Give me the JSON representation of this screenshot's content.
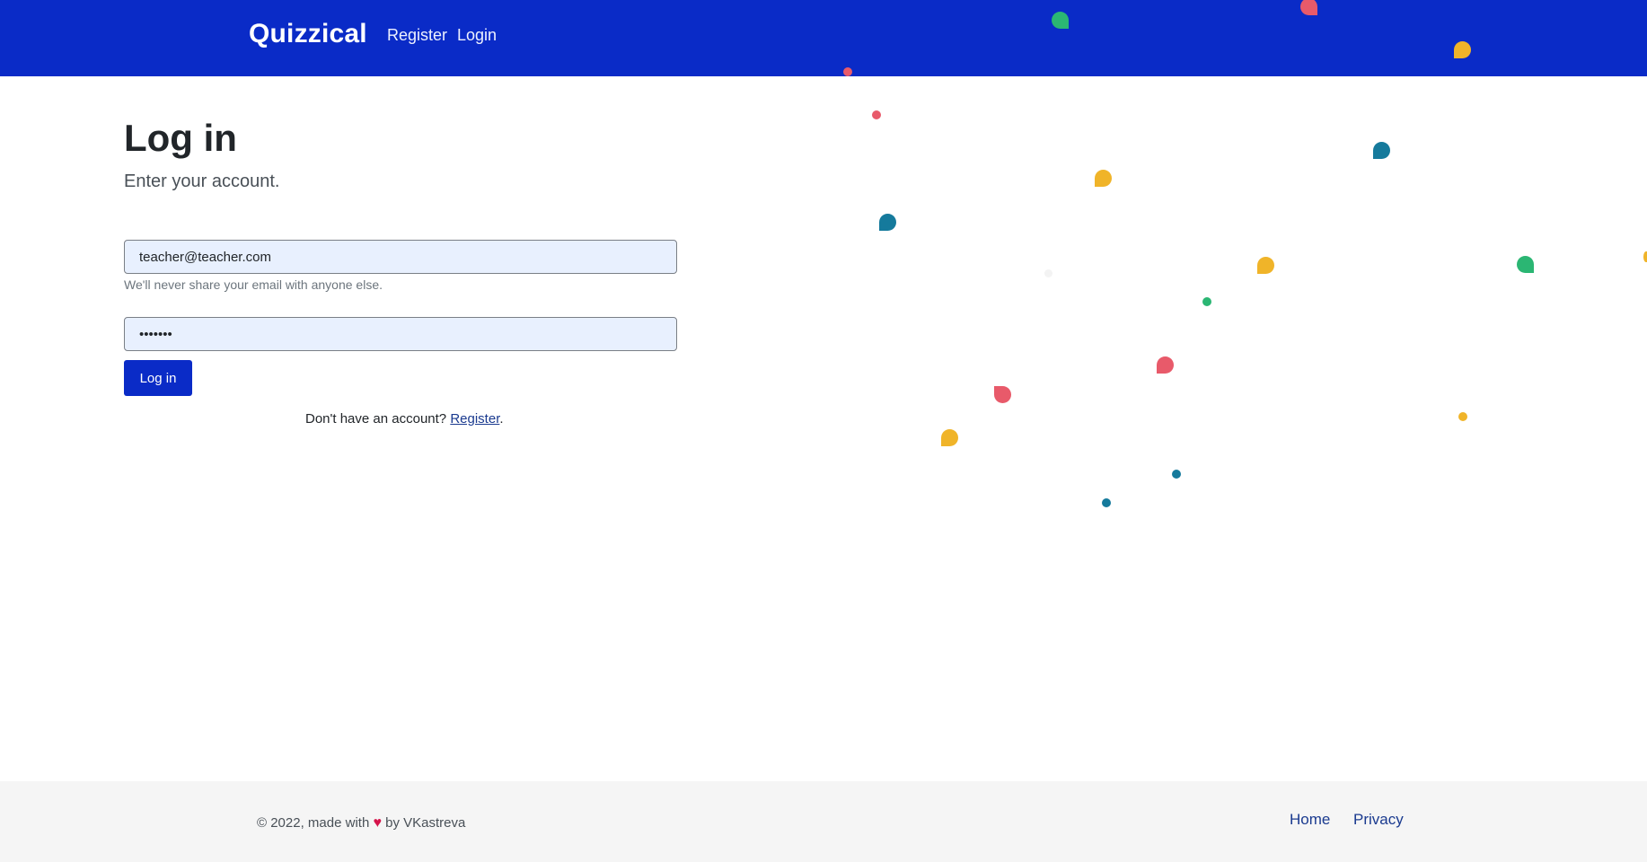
{
  "navbar": {
    "brand": "Quizzical",
    "links": [
      {
        "label": "Register"
      },
      {
        "label": "Login"
      }
    ]
  },
  "main": {
    "title": "Log in",
    "subtitle": "Enter your account.",
    "email": {
      "value": "teacher@teacher.com",
      "help": "We'll never share your email with anyone else."
    },
    "password": {
      "value": "•••••••"
    },
    "submit_label": "Log in",
    "register_prompt": "Don't have an account?",
    "register_link": "Register",
    "register_suffix": "."
  },
  "footer": {
    "copyright": "© 2022, made with",
    "heart": "♥",
    "author": "by VKastreva",
    "links": [
      {
        "label": "Home"
      },
      {
        "label": "Privacy"
      }
    ]
  },
  "colors": {
    "brand_blue": "#0a2bc7",
    "confetti_red": "#e85a6a",
    "confetti_yellow": "#f0b429",
    "confetti_green": "#2bb673",
    "confetti_teal": "#157a9c",
    "heart_red": "#d6144b"
  }
}
